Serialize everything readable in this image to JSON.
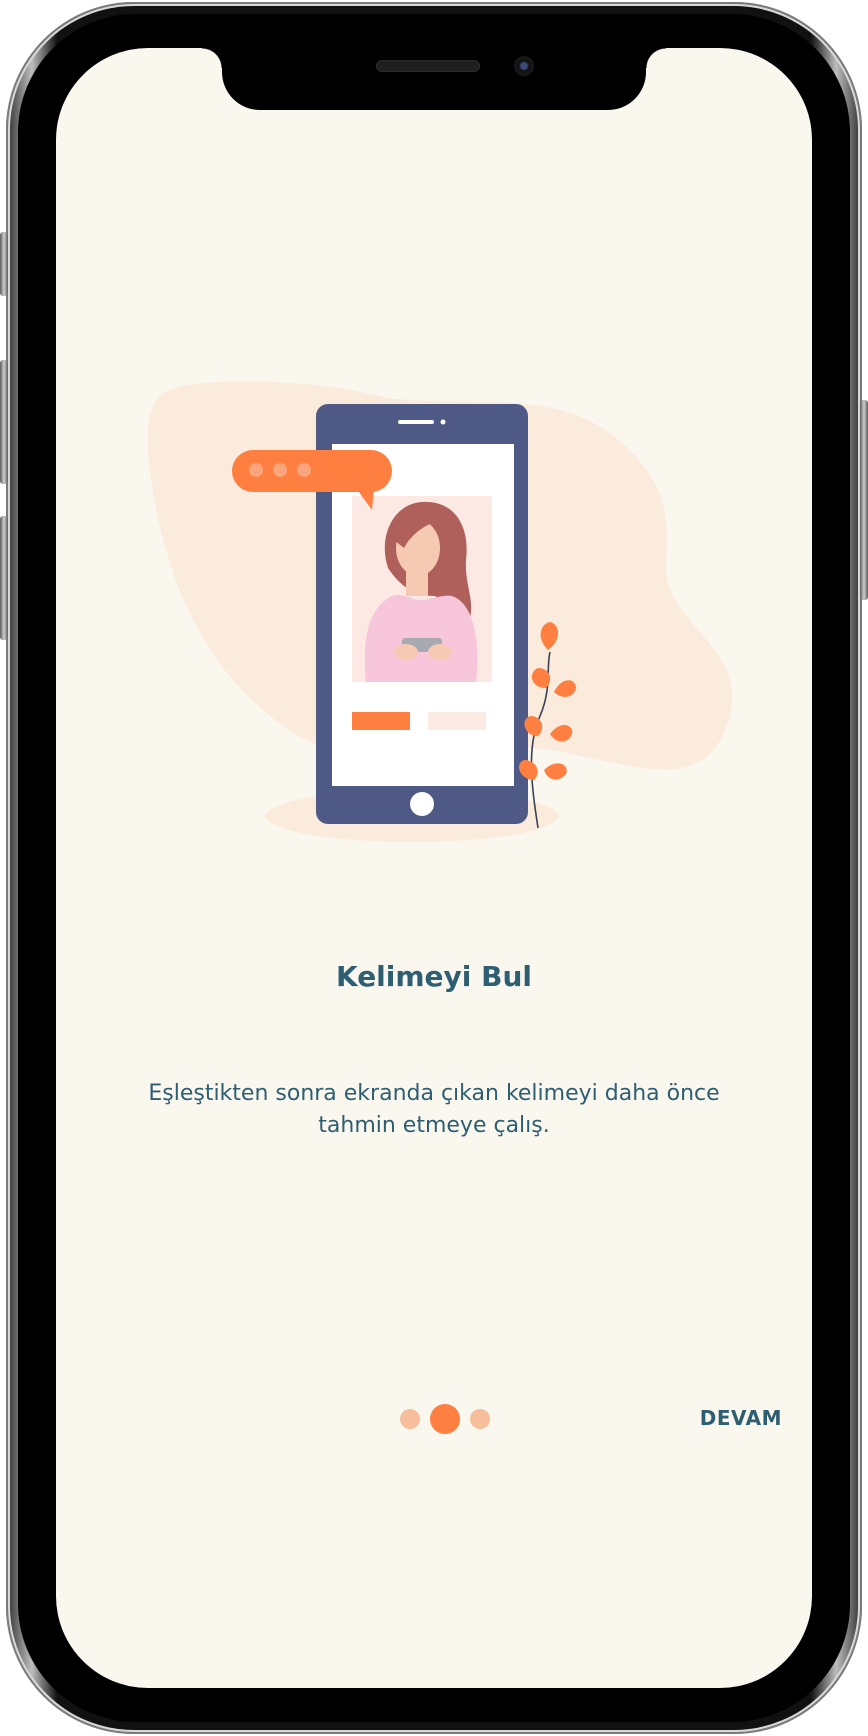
{
  "onboarding": {
    "title": "Kelimeyi Bul",
    "description": "Eşleştikten sonra ekranda çıkan kelimeyi daha önce tahmin etmeye çalış.",
    "next_label": "DEVAM",
    "page_indicator": {
      "current": 2,
      "total": 3
    }
  },
  "colors": {
    "background": "#FAF7EF",
    "accent": "#FF7F41",
    "accent_light": "#F6BE9A",
    "text": "#2E5E72",
    "phone_body": "#4E5A85",
    "blob": "#FAEBDC"
  },
  "icons": {
    "illustration": "phone-with-woman-illustration",
    "chat_bubble": "chat-bubble-icon",
    "plant": "plant-icon"
  }
}
